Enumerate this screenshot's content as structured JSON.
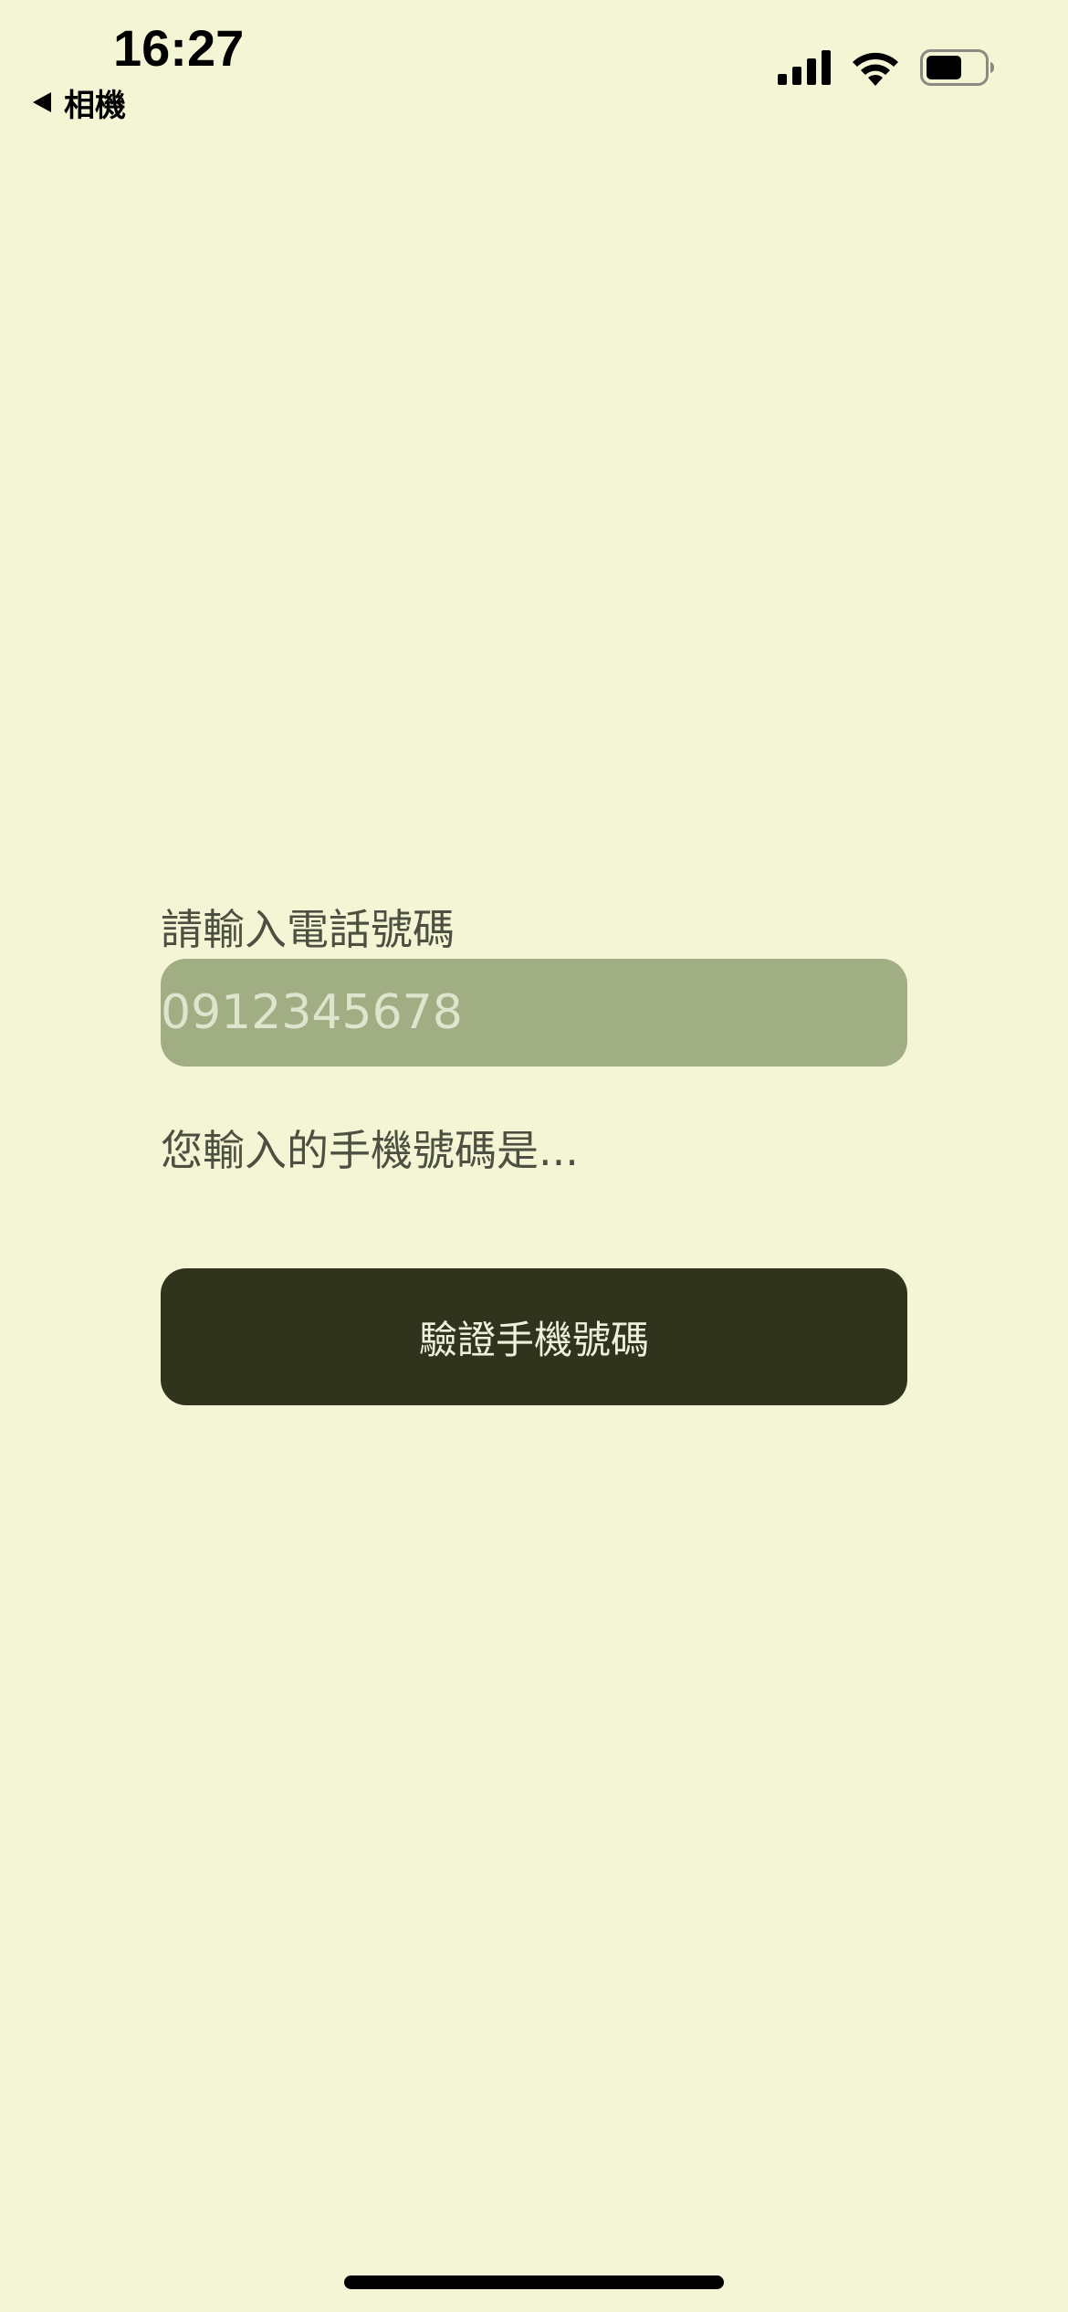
{
  "status_bar": {
    "time": "16:27",
    "back_label": "相機"
  },
  "icons": {
    "signal": "cellular-signal-icon",
    "wifi": "wifi-icon",
    "battery": "battery-icon",
    "back": "back-arrow-icon"
  },
  "form": {
    "phone_label": "請輸入電話號碼",
    "phone_placeholder": "0912345678",
    "phone_value": "",
    "result_text": "您輸入的手機號碼是...",
    "verify_button_label": "驗證手機號碼"
  },
  "colors": {
    "background": "#f3f5d5",
    "input_fill": "#a1ad83",
    "button_fill": "#30341c",
    "button_text": "#eef0dc"
  }
}
